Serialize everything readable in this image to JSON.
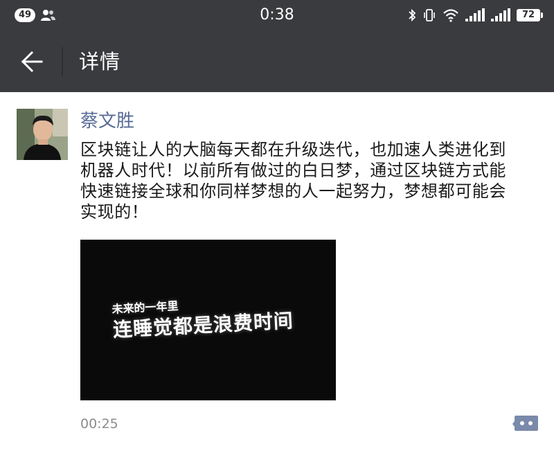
{
  "status_bar": {
    "notification_count": "49",
    "time": "0:38",
    "battery": "72"
  },
  "header": {
    "title": "详情"
  },
  "post": {
    "author": "蔡文胜",
    "text": "区块链让人的大脑每天都在升级迭代，也加速人类进化到\n机器人时代！以前所有做过的白日梦，通过区块链方式能\n快速链接全球和你同样梦想的人一起努力，梦想都可能会\n实现的！",
    "video": {
      "caption_line1": "未来的一年里",
      "caption_line2": "连睡觉都是浪费时间"
    },
    "time": "00:25"
  },
  "icons": {
    "back": "back-arrow-icon",
    "comment": "comment-bubble-icon"
  },
  "colors": {
    "bar_background": "#3a3b3e",
    "author_link": "#576b95",
    "comment_icon": "#7a8aaa"
  }
}
